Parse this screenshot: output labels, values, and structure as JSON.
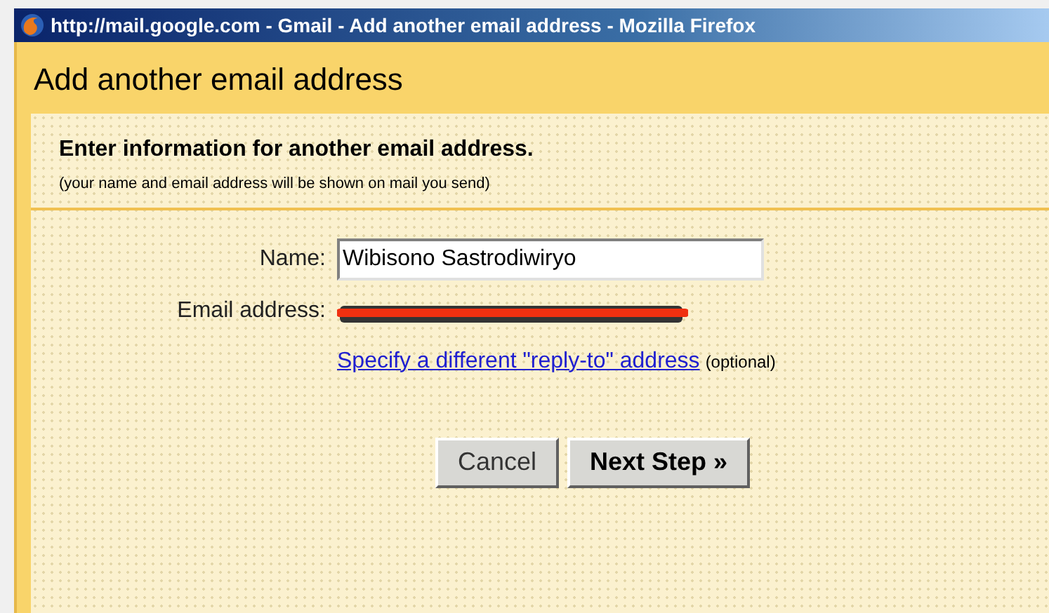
{
  "window": {
    "title": "http://mail.google.com - Gmail - Add another email address - Mozilla Firefox"
  },
  "heading": "Add another email address",
  "intro": {
    "title": "Enter information for another email address.",
    "note": "(your name and email address will be shown on mail you send)"
  },
  "form": {
    "name_label": "Name:",
    "name_value": "Wibisono Sastrodiwiryo",
    "email_label": "Email address:",
    "reply_to_link": "Specify a different \"reply-to\" address",
    "reply_to_note": "(optional)"
  },
  "buttons": [
    {
      "label": "Cancel",
      "kind": "secondary"
    },
    {
      "label": "Next Step »",
      "kind": "primary"
    }
  ]
}
